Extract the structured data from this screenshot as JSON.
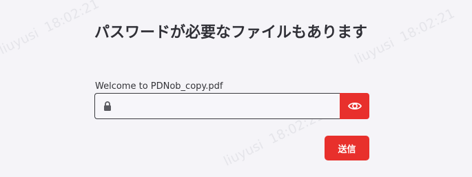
{
  "dialog": {
    "title": "パスワードが必要なファイルもあります",
    "file_label": "Welcome to PDNob_copy.pdf",
    "password_value": "",
    "submit_label": "送信"
  },
  "icons": {
    "lock": "lock-icon",
    "eye": "eye-icon"
  },
  "colors": {
    "accent": "#e8302c",
    "background": "#f5f4f8"
  },
  "watermark": {
    "user": "liuyusi",
    "time": "18:02:21"
  }
}
